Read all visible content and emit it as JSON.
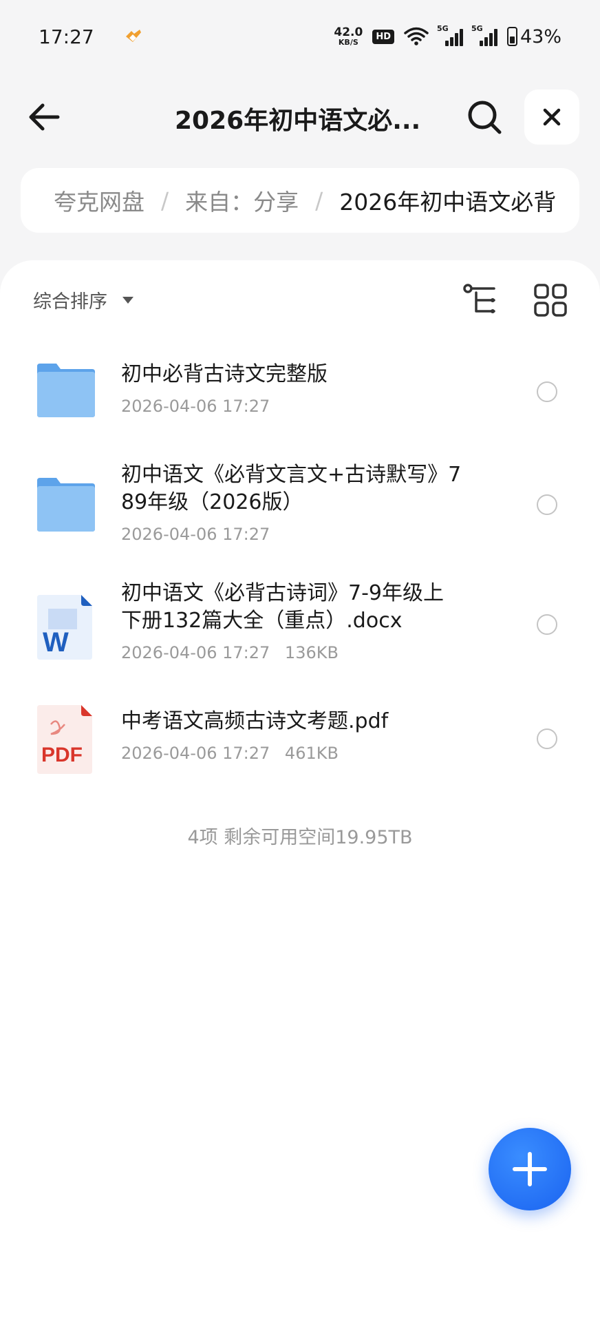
{
  "status_bar": {
    "time": "17:27",
    "net_speed_value": "42.0",
    "net_speed_unit": "KB/S",
    "hd_label": "HD",
    "sim1_label": "5G",
    "sim2_label": "5G",
    "battery_percent": "43%"
  },
  "header": {
    "title": "2026年初中语文必..."
  },
  "breadcrumb": {
    "items": [
      "夸克网盘",
      "来自：分享",
      "2026年初中语文必背"
    ]
  },
  "toolbar": {
    "sort_label": "综合排序"
  },
  "files": [
    {
      "name": "初中必背古诗文完整版",
      "date": "2026-04-06 17:27",
      "size": "",
      "type": "folder"
    },
    {
      "name": "初中语文《必背文言文+古诗默写》7\n89年级（2026版）",
      "date": "2026-04-06 17:27",
      "size": "",
      "type": "folder"
    },
    {
      "name": "初中语文《必背古诗词》7-9年级上\n下册132篇大全（重点）.docx",
      "date": "2026-04-06 17:27",
      "size": "136KB",
      "type": "docx"
    },
    {
      "name": "中考语文高频古诗文考题.pdf",
      "date": "2026-04-06 17:27",
      "size": "461KB",
      "type": "pdf"
    }
  ],
  "footer": {
    "summary": "4项 剩余可用空间19.95TB"
  },
  "icons": {
    "back": "arrow-left-icon",
    "search": "search-icon",
    "close": "close-icon",
    "tree": "tree-view-icon",
    "grid": "grid-view-icon",
    "add": "plus-icon"
  },
  "colors": {
    "accent": "#1a63f0",
    "folder": "#7ab8ef",
    "word": "#1f5fbf",
    "pdf": "#d9362b"
  }
}
